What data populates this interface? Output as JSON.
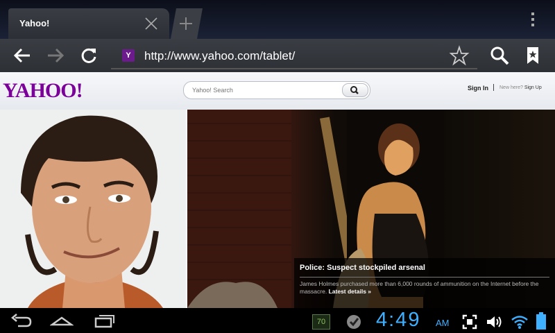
{
  "browser": {
    "tab_title": "Yahoo!",
    "url": "http://www.yahoo.com/tablet/"
  },
  "yahoo": {
    "logo": "YAHOO!",
    "search_placeholder": "Yahoo! Search",
    "sign_in": "Sign In",
    "new_here": "New here?",
    "sign_up": "Sign Up"
  },
  "story": {
    "headline": "Police: Suspect stockpiled arsenal",
    "body": "James Holmes purchased more than 6,000 rounds of ammunition on the Internet before the massacre.",
    "link": "Latest details »"
  },
  "status": {
    "time": "4:49",
    "ampm": "AM",
    "notification_badge": "70"
  },
  "icons": {
    "back": "back-arrow-icon",
    "forward": "forward-arrow-icon",
    "reload": "reload-icon",
    "bookmark": "star-icon",
    "search": "search-icon",
    "bookmarks": "bookmarks-icon"
  },
  "colors": {
    "yahoo_purple": "#7b0099",
    "clock_blue": "#3fb0ff"
  }
}
